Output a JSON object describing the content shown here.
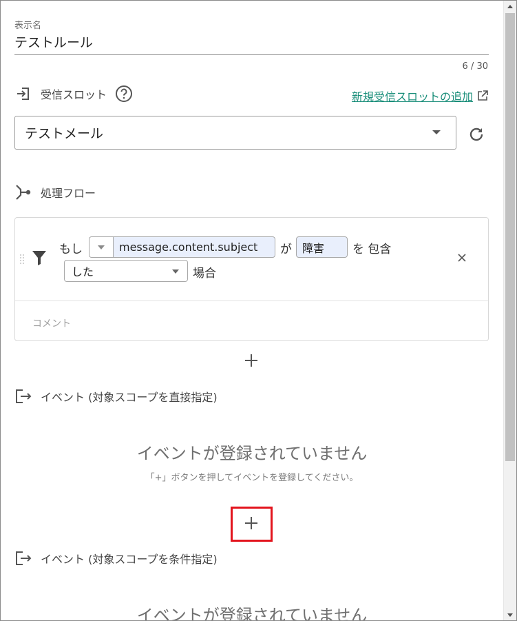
{
  "display_name": {
    "label": "表示名",
    "value": "テストルール",
    "counter": "6 / 30"
  },
  "receive_slot": {
    "label": "受信スロット",
    "add_link": "新規受信スロットの追加",
    "selected": "テストメール"
  },
  "flow": {
    "label": "処理フロー",
    "condition": {
      "prefix": "もし",
      "field": "message.content.subject",
      "particle_ga": "が",
      "value": "障害",
      "particle_wo": "を 包含",
      "result": "した",
      "suffix": "場合"
    },
    "comment_placeholder": "コメント"
  },
  "event_direct": {
    "label": "イベント (対象スコープを直接指定)",
    "empty_title": "イベントが登録されていません",
    "empty_hint": "「+」ボタンを押してイベントを登録してください。"
  },
  "event_conditional": {
    "label": "イベント (対象スコープを条件指定)",
    "empty_title": "イベントが登録されていません"
  },
  "colors": {
    "link": "#1a8e7a",
    "highlight": "#e3141d",
    "input_bg": "#e9effc"
  }
}
